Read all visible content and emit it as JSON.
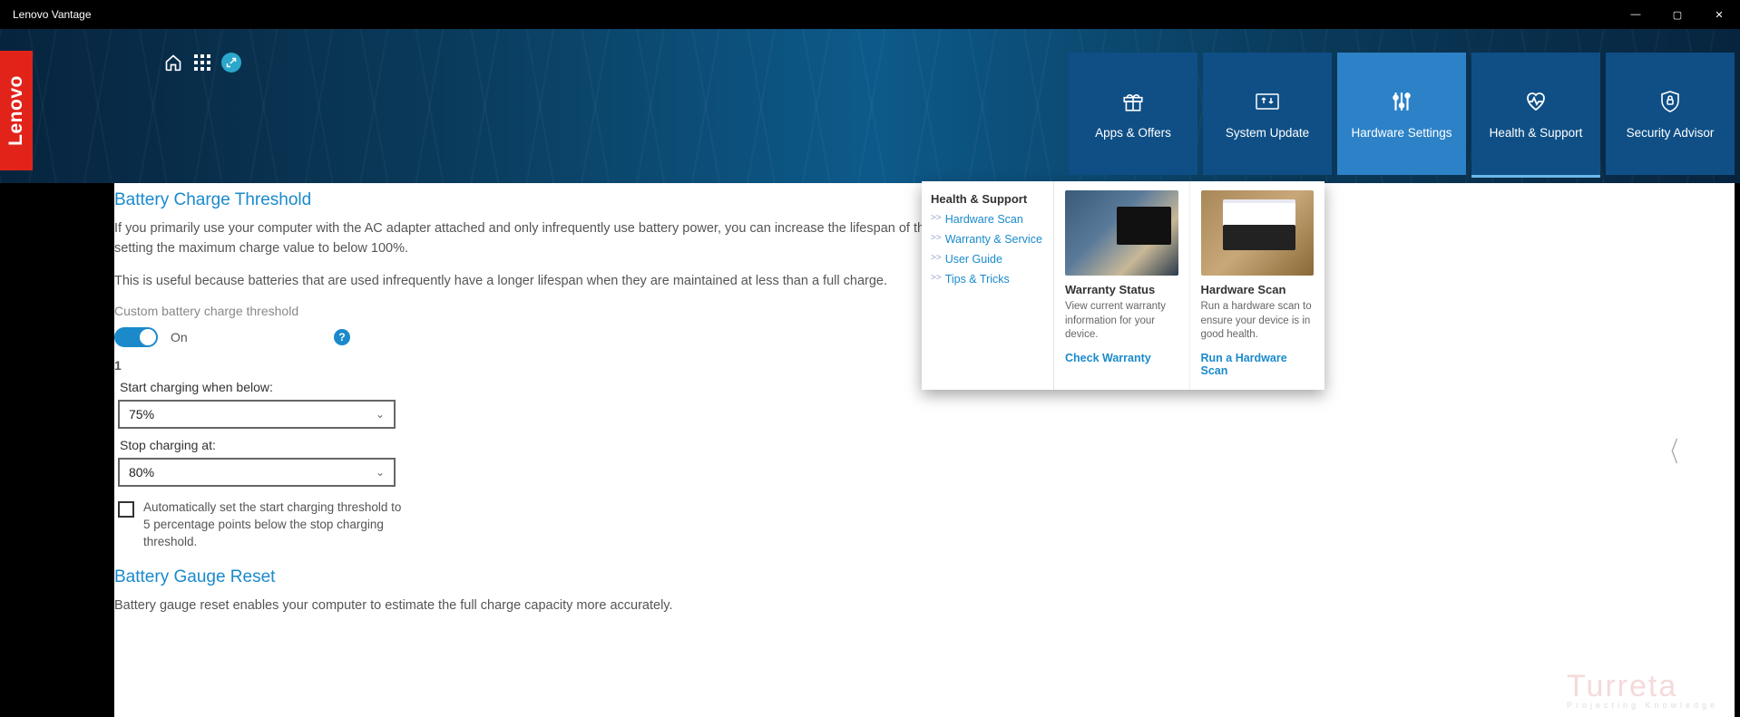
{
  "titlebar": {
    "title": "Lenovo Vantage"
  },
  "brand": "Lenovo",
  "nav": {
    "apps": "Apps & Offers",
    "update": "System Update",
    "hardware": "Hardware Settings",
    "health": "Health & Support",
    "security": "Security Advisor"
  },
  "dropdown": {
    "title": "Health & Support",
    "links": {
      "scan": "Hardware Scan",
      "warranty": "Warranty & Service",
      "guide": "User Guide",
      "tips": "Tips & Tricks"
    },
    "card_warranty": {
      "title": "Warranty Status",
      "desc": "View current warranty information for your device.",
      "action": "Check Warranty"
    },
    "card_hw": {
      "title": "Hardware Scan",
      "desc": "Run a hardware scan to ensure your device is in good health.",
      "action": "Run a Hardware Scan"
    }
  },
  "page": {
    "h_threshold": "Battery Charge Threshold",
    "p1": "If you primarily use your computer with the AC adapter attached and only infrequently use battery power, you can increase the lifespan of the battery by setting the maximum charge value to below 100%.",
    "p2": "This is useful because batteries that are used infrequently have a longer lifespan when they are maintained at less than a full charge.",
    "custom_label": "Custom battery charge threshold",
    "toggle_state": "On",
    "battery_num": "1",
    "start_label": "Start charging when below:",
    "start_value": "75%",
    "stop_label": "Stop charging at:",
    "stop_value": "80%",
    "auto_check": "Automatically set the start charging threshold to 5 percentage points below the stop charging threshold.",
    "h_gauge": "Battery Gauge Reset",
    "p_gauge": "Battery gauge reset enables your computer to estimate the full charge capacity more accurately."
  },
  "watermark": {
    "main": "Turreta",
    "sub": "Projecting Knowledge"
  }
}
